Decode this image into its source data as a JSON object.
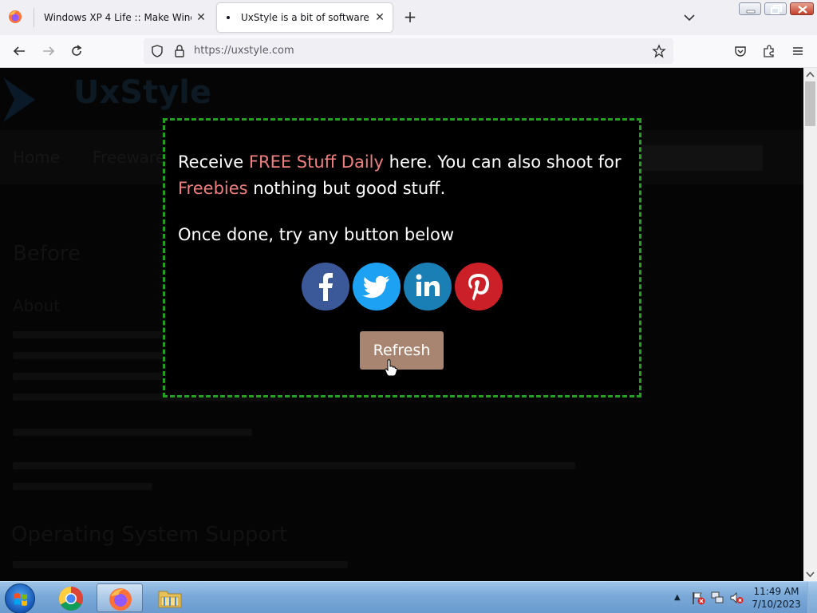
{
  "browser": {
    "tabs": [
      {
        "title": "Windows XP 4 Life :: Make Windows"
      },
      {
        "title": "UxStyle is a bit of software that"
      }
    ],
    "url": "https://uxstyle.com"
  },
  "popup": {
    "line1_a": "Receive ",
    "line1_highlight": "FREE Stuff Daily",
    "line1_b": " here. You can also shoot for",
    "line2_highlight": "Freebies",
    "line2_b": " nothing but good stuff.",
    "line3": "Once done, try any button below",
    "refresh_label": "Refresh",
    "social_buttons": [
      "facebook",
      "twitter",
      "linkedin",
      "pinterest"
    ]
  },
  "background_page": {
    "logo": "UxStyle",
    "nav": [
      "Home",
      "Freeware"
    ],
    "heading": "Before",
    "subheading": "About",
    "section_heading": "Operating System Support"
  },
  "taskbar": {
    "time": "11:49 AM",
    "date": "7/10/2023"
  },
  "colors": {
    "highlight": "#f08080",
    "popup_border": "#23a020",
    "refresh_button": "#a88571",
    "facebook": "#3b5998",
    "twitter": "#1da1f2",
    "linkedin": "#1a7fb5",
    "pinterest": "#cb2027"
  }
}
